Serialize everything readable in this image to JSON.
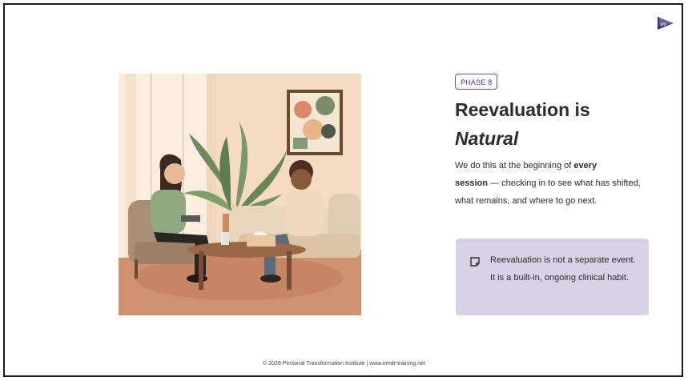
{
  "slide": {
    "badge": "PHASE 8",
    "title_line1": "Reevaluation is",
    "title_line2": "Natural",
    "body": {
      "part1": "We do this at the beginning of ",
      "bold1": "every",
      "bold2": "session",
      "part2": " — checking in to see what has shifted, what remains, and where to go next."
    },
    "callout": {
      "icon": "note-icon",
      "text": "Reevaluation is not a separate event. It is a built-in, ongoing clinical habit."
    }
  },
  "logo": {
    "text": "pti",
    "color": "#3a2a7a"
  },
  "footer": {
    "text": "© 2026 Personal Transformation Institute | www.emdr-training.net"
  },
  "colors": {
    "accent": "#6a4f9c",
    "callout_bg": "#d9d1e6"
  }
}
